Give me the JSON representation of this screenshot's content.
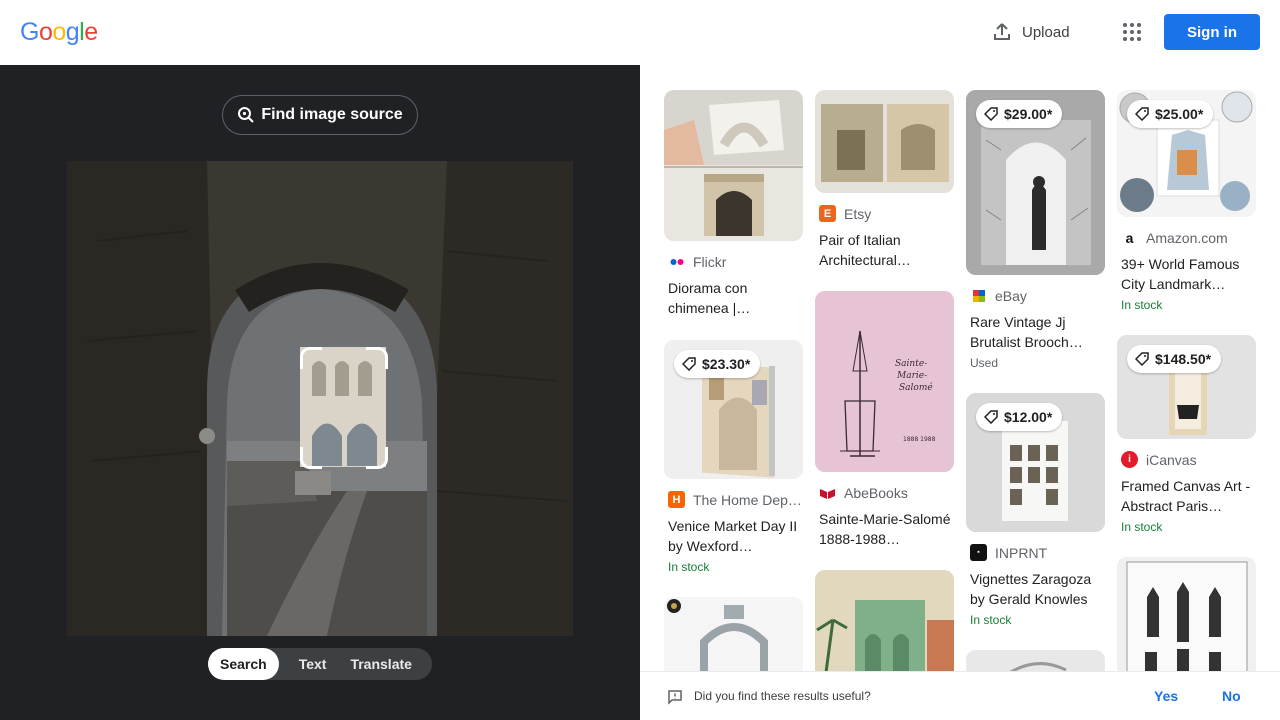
{
  "header": {
    "logo_letters": [
      "G",
      "o",
      "o",
      "g",
      "l",
      "e"
    ],
    "upload_label": "Upload",
    "apps_icon": "apps-grid-icon",
    "signin_label": "Sign in"
  },
  "lens": {
    "find_source_label": "Find image source",
    "tabs": [
      {
        "label": "Search",
        "active": true
      },
      {
        "label": "Text",
        "active": false
      },
      {
        "label": "Translate",
        "active": false
      }
    ]
  },
  "results": [
    {
      "source": "Flickr",
      "title": "Diorama con chimenea |…",
      "price": "",
      "stock": "",
      "condition": ""
    },
    {
      "source": "The Home Dep…",
      "title": "Venice Market Day II by Wexford…",
      "price": "$23.30*",
      "stock": "In stock",
      "condition": ""
    },
    {
      "source": "Etsy",
      "title": "Pair of Italian Architectural…",
      "price": "",
      "stock": "",
      "condition": ""
    },
    {
      "source": "AbeBooks",
      "title": "Sainte-Marie-Salomé 1888-1988…",
      "price": "",
      "stock": "",
      "condition": ""
    },
    {
      "source": "eBay",
      "title": "Rare Vintage Jj Brutalist Brooch…",
      "price": "$29.00*",
      "stock": "",
      "condition": "Used"
    },
    {
      "source": "INPRNT",
      "title": "Vignettes Zaragoza by Gerald Knowles",
      "price": "$12.00*",
      "stock": "In stock",
      "condition": ""
    },
    {
      "source": "Amazon.com",
      "title": "39+ World Famous City Landmark…",
      "price": "$25.00*",
      "stock": "In stock",
      "condition": ""
    },
    {
      "source": "iCanvas",
      "title": "Framed Canvas Art - Abstract Paris…",
      "price": "$148.50*",
      "stock": "In stock",
      "condition": ""
    }
  ],
  "thumb_text": {
    "abebooks_line1": "Sainte-",
    "abebooks_line2": "Marie-",
    "abebooks_line3": "Salomé",
    "abebooks_years": "1888 1988"
  },
  "feedback": {
    "question": "Did you find these results useful?",
    "yes": "Yes",
    "no": "No"
  },
  "colors": {
    "accent": "#1a73e8",
    "dark_panel": "#202124",
    "in_stock": "#188038"
  }
}
